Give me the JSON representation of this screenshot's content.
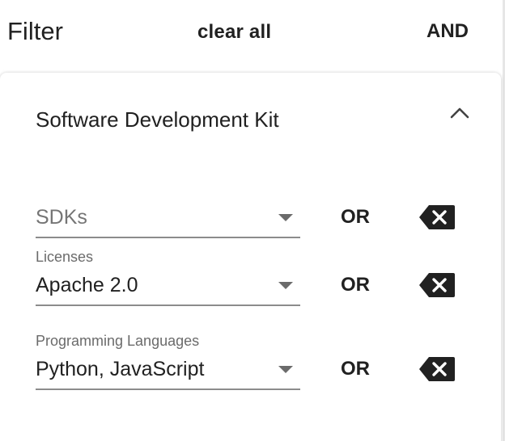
{
  "header": {
    "title": "Filter",
    "clear_all_label": "clear all",
    "operator_label": "AND"
  },
  "section": {
    "title": "Software Development Kit",
    "expanded": true,
    "toggle_icon": "chevron-up-icon"
  },
  "filters": [
    {
      "label": "",
      "placeholder": "SDKs",
      "value": "",
      "operator": "OR",
      "delete_icon": "backspace-icon"
    },
    {
      "label": "Licenses",
      "placeholder": "",
      "value": "Apache 2.0",
      "operator": "OR",
      "delete_icon": "backspace-icon"
    },
    {
      "label": "Programming Languages",
      "placeholder": "",
      "value": "Python, JavaScript",
      "operator": "OR",
      "delete_icon": "backspace-icon"
    }
  ],
  "colors": {
    "text": "#212121",
    "muted": "#6b6b6b",
    "underline": "#8c8c8c",
    "icon": "#212121"
  }
}
